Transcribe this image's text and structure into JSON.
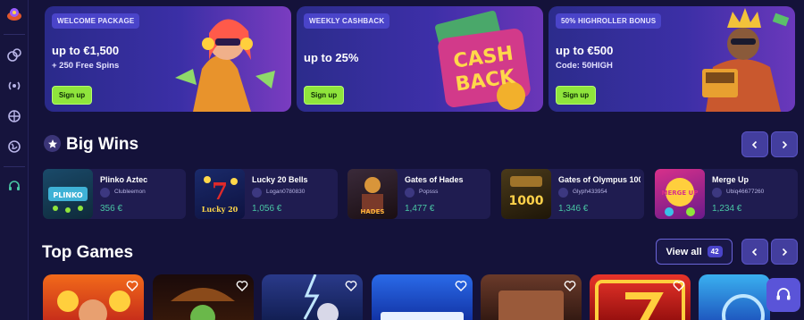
{
  "promos": [
    {
      "badge": "WELCOME PACKAGE",
      "main": "up to €1,500",
      "sub": "+ 250 Free Spins",
      "button": "Sign up"
    },
    {
      "badge": "WEEKLY CASHBACK",
      "main": "up to 25%",
      "sub": "",
      "button": "Sign up"
    },
    {
      "badge": "50% HIGHROLLER BONUS",
      "main": "up to €500",
      "sub": "Code: 50HIGH",
      "button": "Sign up"
    }
  ],
  "cashback_art": {
    "line1": "CASH",
    "line2": "BACK"
  },
  "big_wins": {
    "title": "Big Wins",
    "items": [
      {
        "game": "Plinko Aztec",
        "user": "Clubleemon",
        "amount": "356 €",
        "thumb_text": "PLINKO"
      },
      {
        "game": "Lucky 20 Bells",
        "user": "Logan0780830",
        "amount": "1,056 €",
        "thumb_text": "Lucky 20"
      },
      {
        "game": "Gates of Hades",
        "user": "Popsss",
        "amount": "1,477 €",
        "thumb_text": "HADES"
      },
      {
        "game": "Gates of Olympus 1000",
        "user": "Glyph433954",
        "amount": "1,346 €",
        "thumb_text": "1000"
      },
      {
        "game": "Merge Up",
        "user": "Ubiq46677260",
        "amount": "1,234 €",
        "thumb_text": "MERGE UP"
      }
    ]
  },
  "top_games": {
    "title": "Top Games",
    "view_all": "View all",
    "count": "42"
  },
  "colors": {
    "accent": "#8fe53c",
    "win_amount": "#49c6a4",
    "background": "#14123a"
  }
}
